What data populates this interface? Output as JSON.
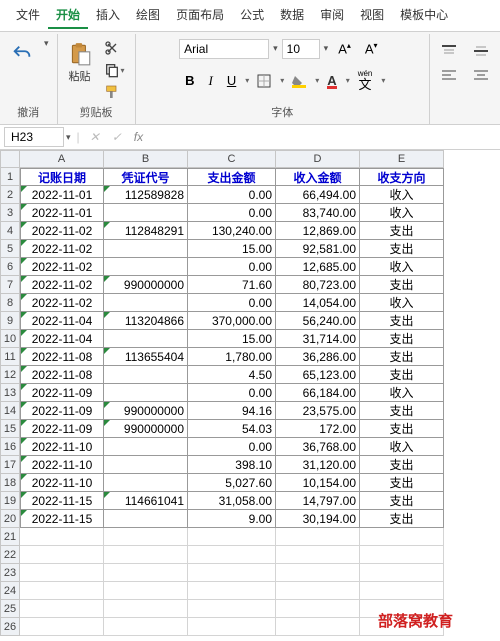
{
  "menu": [
    "文件",
    "开始",
    "插入",
    "绘图",
    "页面布局",
    "公式",
    "数据",
    "审阅",
    "视图",
    "模板中心"
  ],
  "activeMenu": 1,
  "ribbon": {
    "undo_label": "撤消",
    "clipboard_label": "剪贴板",
    "paste_label": "粘贴",
    "font_group_label": "字体",
    "font_name": "Arial",
    "font_size": "10",
    "wen_label": "wén",
    "wen_sub": "文"
  },
  "namebox": "H23",
  "cols": [
    "A",
    "B",
    "C",
    "D",
    "E"
  ],
  "headers": [
    "记账日期",
    "凭证代号",
    "支出金额",
    "收入金额",
    "收支方向"
  ],
  "rows": [
    [
      "2022-11-01",
      "112589828",
      "0.00",
      "66,494.00",
      "收入"
    ],
    [
      "2022-11-01",
      "",
      "0.00",
      "83,740.00",
      "收入"
    ],
    [
      "2022-11-02",
      "112848291",
      "130,240.00",
      "12,869.00",
      "支出"
    ],
    [
      "2022-11-02",
      "",
      "15.00",
      "92,581.00",
      "支出"
    ],
    [
      "2022-11-02",
      "",
      "0.00",
      "12,685.00",
      "收入"
    ],
    [
      "2022-11-02",
      "990000000",
      "71.60",
      "80,723.00",
      "支出"
    ],
    [
      "2022-11-02",
      "",
      "0.00",
      "14,054.00",
      "收入"
    ],
    [
      "2022-11-04",
      "113204866",
      "370,000.00",
      "56,240.00",
      "支出"
    ],
    [
      "2022-11-04",
      "",
      "15.00",
      "31,714.00",
      "支出"
    ],
    [
      "2022-11-08",
      "113655404",
      "1,780.00",
      "36,286.00",
      "支出"
    ],
    [
      "2022-11-08",
      "",
      "4.50",
      "65,123.00",
      "支出"
    ],
    [
      "2022-11-09",
      "",
      "0.00",
      "66,184.00",
      "收入"
    ],
    [
      "2022-11-09",
      "990000000",
      "94.16",
      "23,575.00",
      "支出"
    ],
    [
      "2022-11-09",
      "990000000",
      "54.03",
      "172.00",
      "支出"
    ],
    [
      "2022-11-10",
      "",
      "0.00",
      "36,768.00",
      "收入"
    ],
    [
      "2022-11-10",
      "",
      "398.10",
      "31,120.00",
      "支出"
    ],
    [
      "2022-11-10",
      "",
      "5,027.60",
      "10,154.00",
      "支出"
    ],
    [
      "2022-11-15",
      "114661041",
      "31,058.00",
      "14,797.00",
      "支出"
    ],
    [
      "2022-11-15",
      "",
      "9.00",
      "30,194.00",
      "支出"
    ]
  ],
  "watermark": "部落窝教育"
}
